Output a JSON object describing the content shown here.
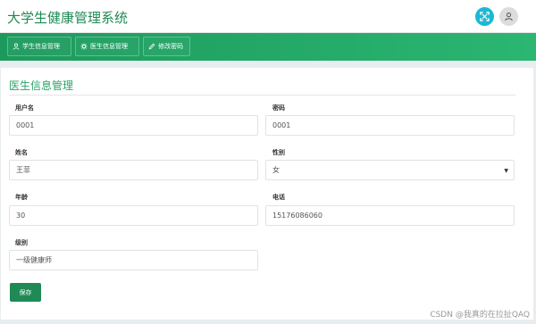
{
  "app": {
    "title": "大学生健康管理系统"
  },
  "header_icons": [
    {
      "icon": "fullscreen-icon"
    },
    {
      "icon": "user-icon"
    }
  ],
  "nav": {
    "items": [
      {
        "label": "学生信息管理",
        "icon": "user-icon"
      },
      {
        "label": "医生信息管理",
        "icon": "gear-icon"
      },
      {
        "label": "修改密码",
        "icon": "edit-icon"
      }
    ]
  },
  "page": {
    "title": "医生信息管理"
  },
  "form": {
    "username": {
      "label": "用户名",
      "value": "0001"
    },
    "password": {
      "label": "密码",
      "value": "0001"
    },
    "name": {
      "label": "姓名",
      "value": "王菲"
    },
    "gender": {
      "label": "性别",
      "value": "女"
    },
    "age": {
      "label": "年龄",
      "value": "30"
    },
    "phone": {
      "label": "电话",
      "value": "15176086060"
    },
    "level": {
      "label": "级别",
      "value": "一级健康师"
    }
  },
  "actions": {
    "save_label": "保存"
  },
  "watermark": "CSDN @我真的在拉扯QAQ",
  "colors": {
    "brand_green": "#1f8a55",
    "nav_gradient_start": "#1c9a5c",
    "nav_gradient_end": "#2bb672",
    "fullscreen_icon_bg": "#1cb8d3"
  }
}
